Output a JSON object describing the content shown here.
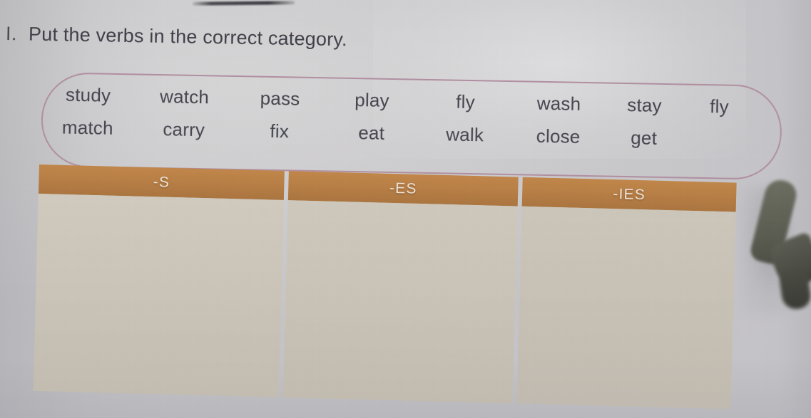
{
  "worksheet": {
    "exercise_number": "I.",
    "instruction": "Put the verbs in the correct category.",
    "word_bank": {
      "row1": [
        "study",
        "watch",
        "pass",
        "play",
        "fly",
        "wash",
        "stay",
        "fly"
      ],
      "row2": [
        "match",
        "carry",
        "fix",
        "eat",
        "walk",
        "close",
        "get"
      ]
    },
    "table": {
      "columns": [
        {
          "header": "-S",
          "entries": ""
        },
        {
          "header": "-ES",
          "entries": ""
        },
        {
          "header": "-IES",
          "entries": ""
        }
      ]
    }
  },
  "colors": {
    "header_band": "#b87f46",
    "header_text": "#efe6da",
    "cell_fill": "#cac4b8",
    "wordbank_border": "#b08fa0",
    "page_background": "#cdccce",
    "body_text": "#45454e"
  }
}
